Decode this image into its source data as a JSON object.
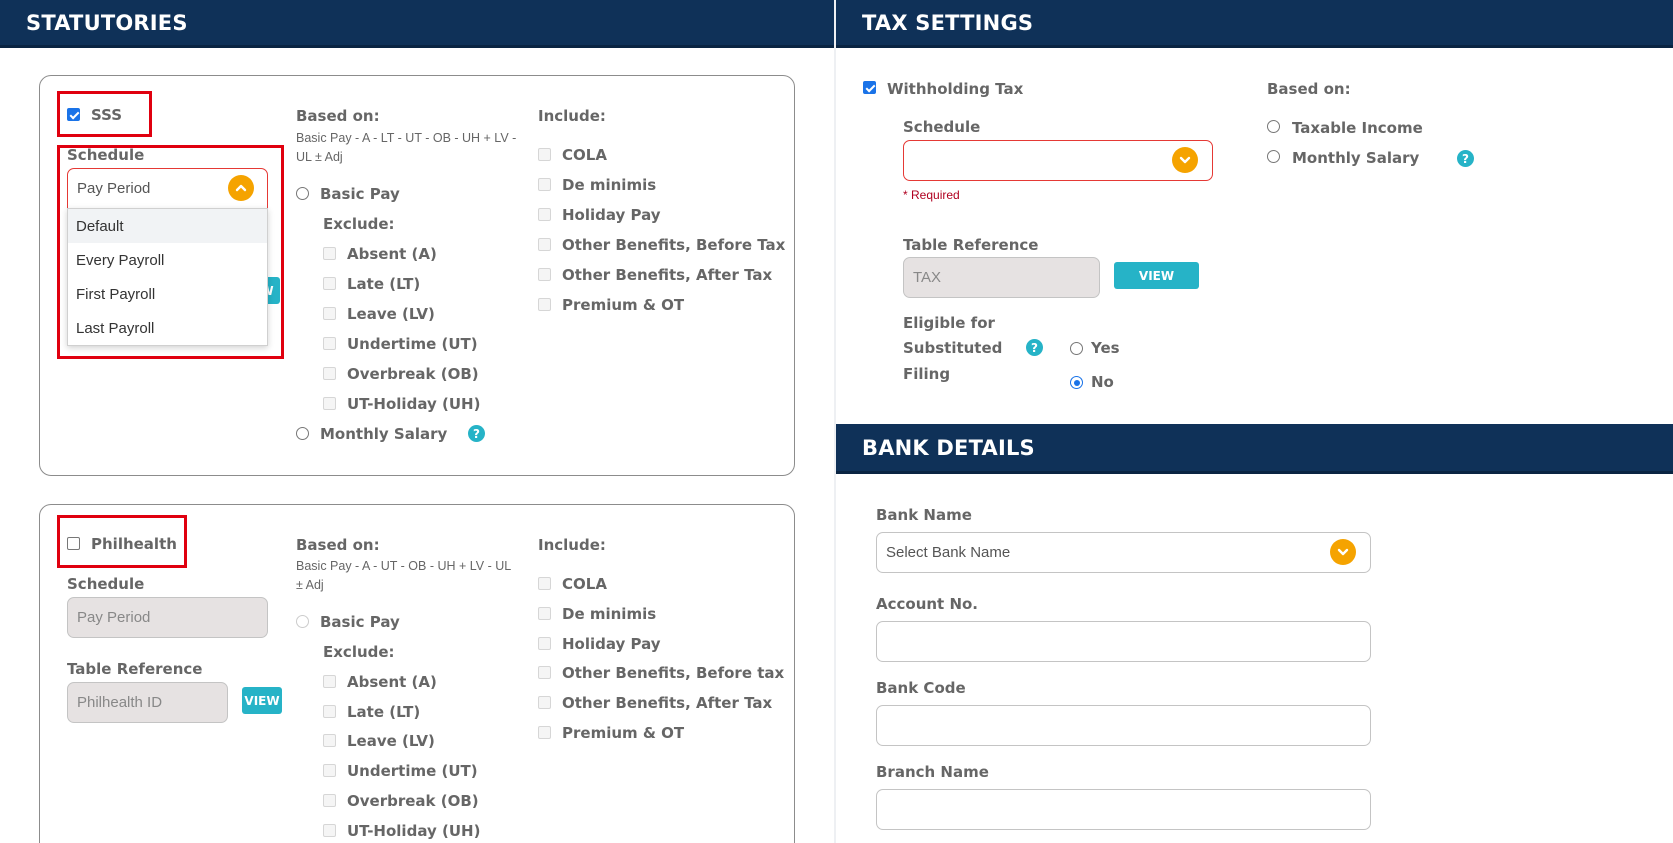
{
  "statutories": {
    "header": "STATUTORIES",
    "sss": {
      "label": "SSS",
      "checked": true,
      "schedule_label": "Schedule",
      "schedule_value": "Pay Period",
      "dropdown_options": [
        "Default",
        "Every Payroll",
        "First Payroll",
        "Last Payroll"
      ],
      "based_on_label": "Based on:",
      "based_on_formula": "Basic Pay - A - LT - UT - OB - UH + LV - UL ± Adj",
      "basic_pay_label": "Basic Pay",
      "exclude_label": "Exclude:",
      "exclude_items": [
        "Absent (A)",
        "Late (LT)",
        "Leave (LV)",
        "Undertime (UT)",
        "Overbreak (OB)",
        "UT-Holiday (UH)"
      ],
      "monthly_salary_label": "Monthly Salary",
      "include_label": "Include:",
      "include_items": [
        "COLA",
        "De minimis",
        "Holiday Pay",
        "Other Benefits, Before Tax",
        "Other Benefits, After Tax",
        "Premium & OT"
      ],
      "view_partial": "W"
    },
    "philhealth": {
      "label": "Philhealth",
      "checked": false,
      "schedule_label": "Schedule",
      "schedule_value": "Pay Period",
      "table_reference_label": "Table Reference",
      "table_reference_value": "Philhealth ID",
      "view_label": "VIEW",
      "based_on_label": "Based on:",
      "based_on_formula": "Basic Pay - A - UT - OB - UH + LV - UL ± Adj",
      "basic_pay_label": "Basic Pay",
      "exclude_label": "Exclude:",
      "exclude_items": [
        "Absent (A)",
        "Late (LT)",
        "Leave (LV)",
        "Undertime (UT)",
        "Overbreak (OB)",
        "UT-Holiday (UH)"
      ],
      "include_label": "Include:",
      "include_items": [
        "COLA",
        "De minimis",
        "Holiday Pay",
        "Other Benefits, Before tax",
        "Other Benefits, After Tax",
        "Premium & OT"
      ]
    }
  },
  "tax_settings": {
    "header": "TAX SETTINGS",
    "withholding_label": "Withholding Tax",
    "withholding_checked": true,
    "schedule_label": "Schedule",
    "schedule_value": "",
    "required_text": "* Required",
    "table_reference_label": "Table Reference",
    "table_reference_value": "TAX",
    "view_label": "VIEW",
    "eligible_line1": "Eligible for",
    "eligible_line2": "Substituted",
    "eligible_line3": "Filing",
    "yes_label": "Yes",
    "no_label": "No",
    "eligible_selected": "No",
    "based_on_label": "Based on:",
    "taxable_income_label": "Taxable Income",
    "monthly_salary_label": "Monthly Salary"
  },
  "bank_details": {
    "header": "BANK DETAILS",
    "bank_name_label": "Bank Name",
    "bank_name_placeholder": "Select Bank Name",
    "account_no_label": "Account No.",
    "account_no_value": "",
    "bank_code_label": "Bank Code",
    "bank_code_value": "",
    "branch_name_label": "Branch Name",
    "branch_name_value": ""
  },
  "colors": {
    "header_bg": "#0f3158",
    "accent_orange": "#f5a300",
    "view_teal": "#26b3c7",
    "highlight_red": "#e0000f"
  }
}
